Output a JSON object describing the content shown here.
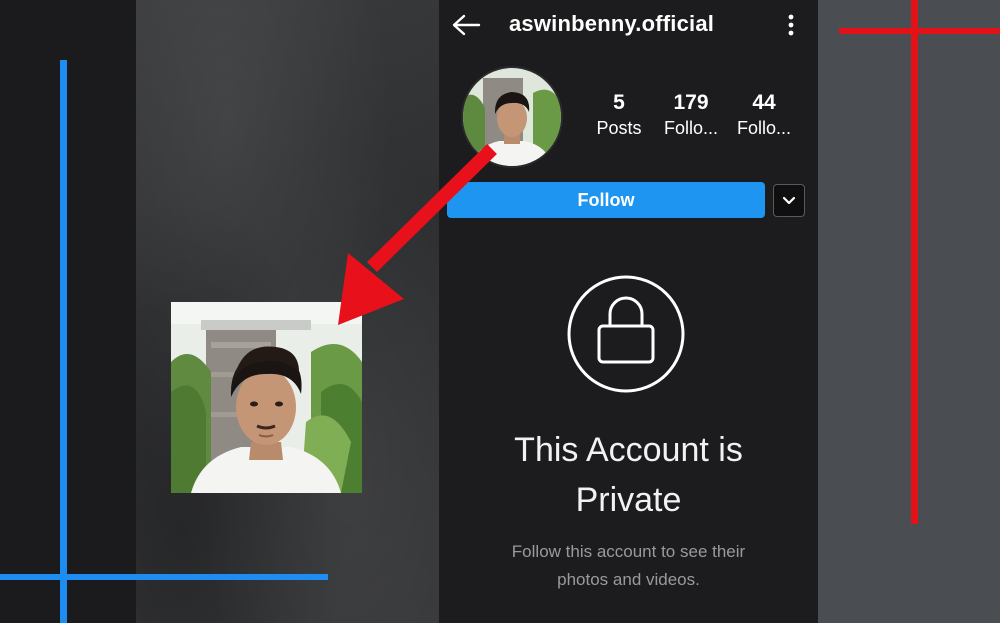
{
  "profile": {
    "username": "aswinbenny.official",
    "stats": [
      {
        "value": "5",
        "label": "Posts"
      },
      {
        "value": "179",
        "label": "Follo..."
      },
      {
        "value": "44",
        "label": "Follo..."
      }
    ],
    "follow_label": "Follow"
  },
  "private_notice": {
    "title_line1": "This Account is",
    "title_line2": "Private",
    "subtitle_line1": "Follow this account to see their",
    "subtitle_line2": "photos and videos."
  },
  "colors": {
    "follow_button": "#1d95f1",
    "accent_blue_lines": "#1e8cf0",
    "accent_red_lines": "#e31218",
    "arrow": "#e8101a"
  },
  "icons": {
    "back": "left-arrow-icon",
    "more": "vertical-dots-icon",
    "dropdown": "chevron-down-icon",
    "lock": "padlock-icon"
  }
}
